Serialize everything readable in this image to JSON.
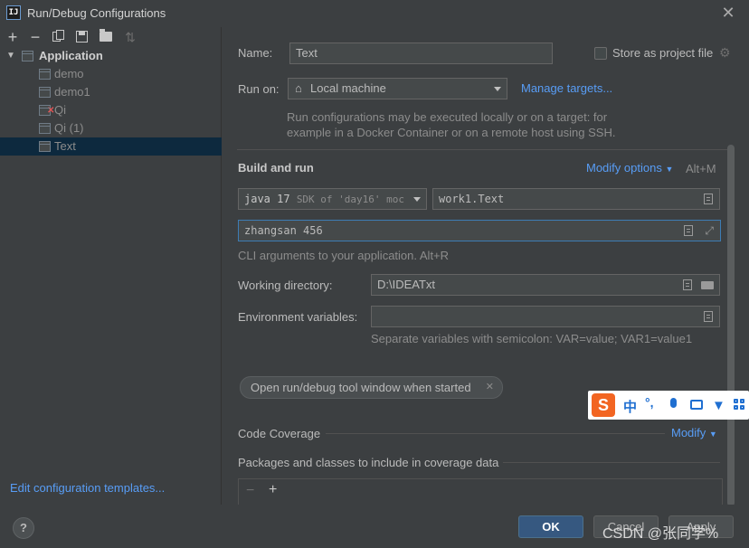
{
  "window": {
    "title": "Run/Debug Configurations",
    "app_icon": "IJ"
  },
  "toolbar": {
    "icons": [
      "add-icon",
      "remove-icon",
      "copy-icon",
      "save-icon",
      "folder-add-icon",
      "sort-icon"
    ]
  },
  "tree": {
    "root": "Application",
    "items": [
      {
        "label": "demo"
      },
      {
        "label": "demo1"
      },
      {
        "label": "Qi"
      },
      {
        "label": "Qi (1)"
      },
      {
        "label": "Text"
      }
    ]
  },
  "left_footer": {
    "link": "Edit configuration templates..."
  },
  "form": {
    "name_label": "Name:",
    "name_value": "Text",
    "store_label": "Store as project file",
    "run_on_label": "Run on:",
    "run_on_value": "Local machine",
    "manage_targets": "Manage targets...",
    "run_on_hint_1": "Run configurations may be executed locally or on a target: for",
    "run_on_hint_2": "example in a Docker Container or on a remote host using SSH.",
    "build_run_title": "Build and run",
    "modify_options": "Modify options",
    "modify_shortcut": "Alt+M",
    "sdk_value": "java 17",
    "sdk_detail": "SDK of 'day16' moc",
    "main_class": "work1.Text",
    "program_args": "zhangsan 456",
    "cli_hint": "CLI arguments to your application. Alt+R",
    "working_dir_label": "Working directory:",
    "working_dir_value": "D:\\IDEATxt",
    "env_label": "Environment variables:",
    "env_value": "",
    "env_hint": "Separate variables with semicolon: VAR=value; VAR1=value1",
    "chip_label": "Open run/debug tool window when started",
    "coverage_label": "Code Coverage",
    "coverage_modify": "Modify",
    "packages_label": "Packages and classes to include in coverage data"
  },
  "ime": {
    "logo": "S",
    "items": [
      "中",
      "°,",
      "mic",
      "kbd",
      "shirt",
      "grid"
    ]
  },
  "buttons": {
    "help": "?",
    "ok": "OK",
    "cancel": "Cancel",
    "apply": "Apply"
  },
  "watermark": "CSDN @张同学%"
}
